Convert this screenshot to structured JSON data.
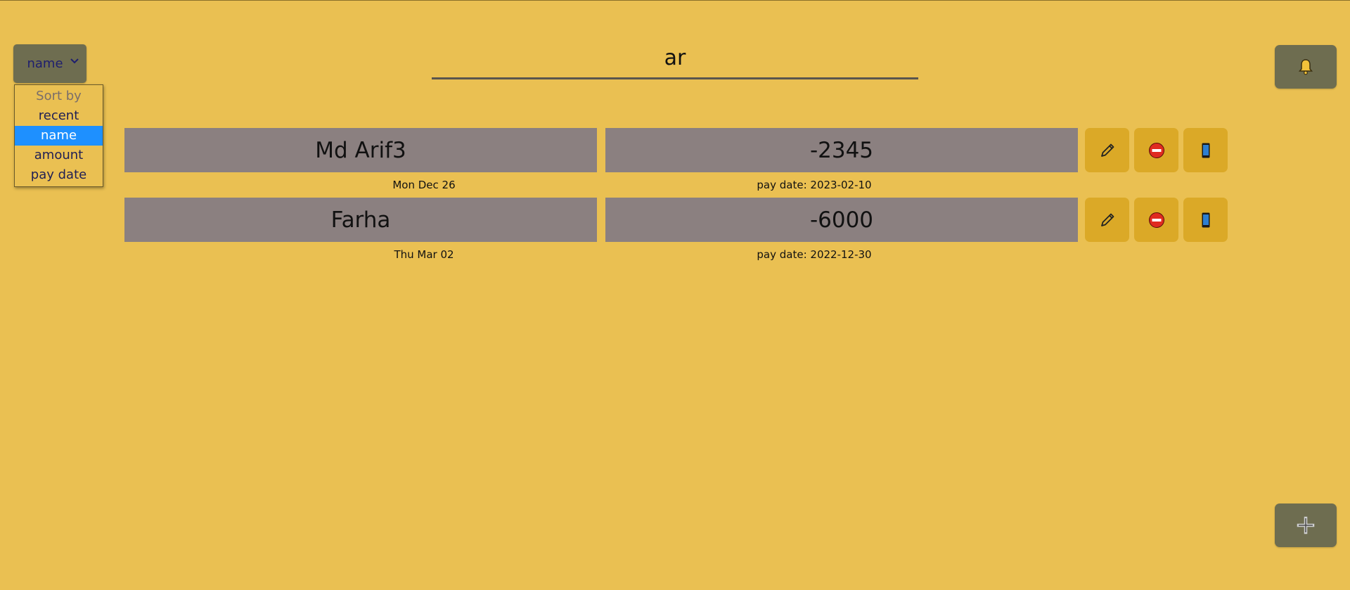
{
  "sort": {
    "selected": "name",
    "options": [
      {
        "label": "Sort by",
        "header": true
      },
      {
        "label": "recent"
      },
      {
        "label": "name",
        "selected": true
      },
      {
        "label": "amount"
      },
      {
        "label": "pay date"
      }
    ]
  },
  "search": {
    "value": "ar"
  },
  "entries": [
    {
      "name": "Md Arif3",
      "amount": "-2345",
      "date": "Mon Dec 26",
      "pay_date": "pay date: 2023-02-10"
    },
    {
      "name": "Farha",
      "amount": "-6000",
      "date": "Thu Mar 02",
      "pay_date": "pay date: 2022-12-30"
    }
  ],
  "icons": {
    "bell": "bell-icon",
    "add": "plus-icon",
    "edit": "pencil-icon",
    "delete": "no-entry-icon",
    "phone": "mobile-phone-icon"
  },
  "colors": {
    "background": "#EAC052",
    "button_dark": "#6E6D50",
    "cell": "#8B8080",
    "row_button": "#DBA927",
    "selected_option": "#1E90FF"
  }
}
